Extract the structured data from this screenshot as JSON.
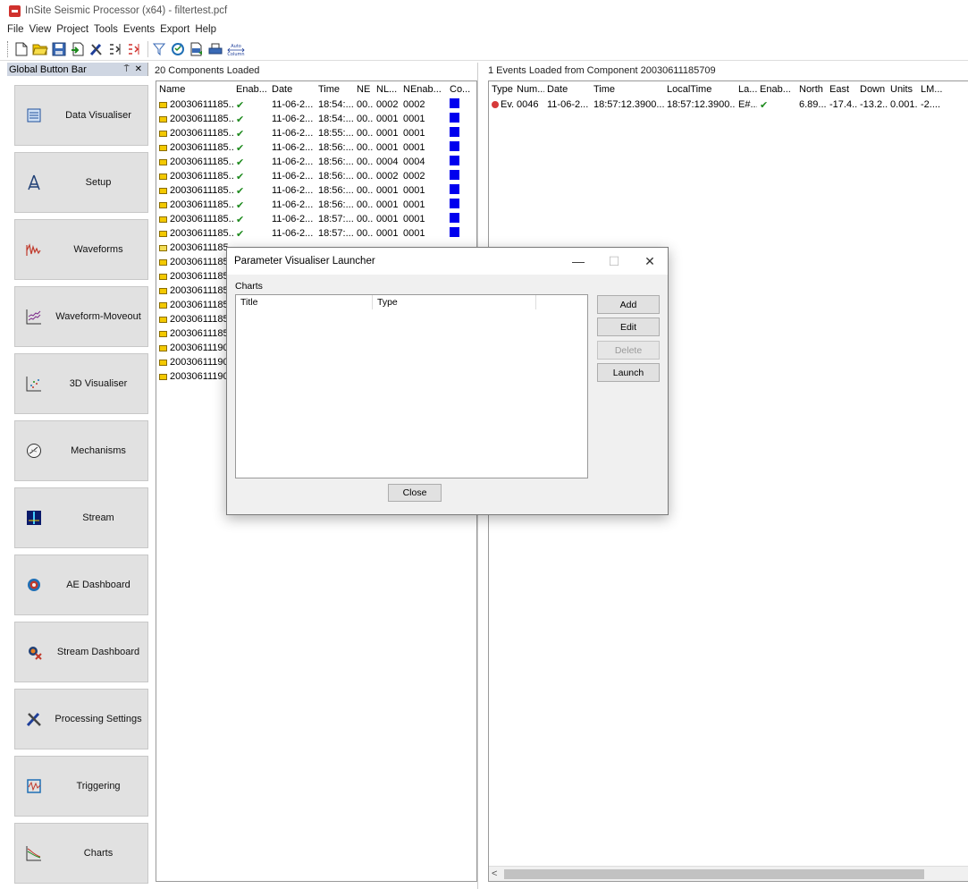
{
  "window": {
    "title": "InSite Seismic Processor (x64) - filtertest.pcf"
  },
  "menu": [
    "File",
    "View",
    "Project",
    "Tools",
    "Events",
    "Export",
    "Help"
  ],
  "toolbar": {
    "icons": [
      "new-icon",
      "open-icon",
      "save-icon",
      "import-icon",
      "tools-icon",
      "select-icon",
      "deselect-icon",
      "filter-icon",
      "refresh-icon",
      "csv-export-icon",
      "print-icon",
      "auto-column-icon"
    ],
    "auto_column_label": "Auto\nColumn"
  },
  "global_button_bar": {
    "title": "Global Button Bar",
    "pin": "⍑",
    "close": "✕",
    "buttons": [
      {
        "label": "Data Visualiser",
        "icon": "data-visualiser-icon"
      },
      {
        "label": "Setup",
        "icon": "setup-rig-icon"
      },
      {
        "label": "Waveforms",
        "icon": "waveforms-icon"
      },
      {
        "label": "Waveform-Moveout",
        "icon": "waveform-moveout-icon"
      },
      {
        "label": "3D Visualiser",
        "icon": "scatter-3d-icon"
      },
      {
        "label": "Mechanisms",
        "icon": "mechanisms-icon"
      },
      {
        "label": "Stream",
        "icon": "stream-icon"
      },
      {
        "label": "AE Dashboard",
        "icon": "ae-dashboard-icon"
      },
      {
        "label": "Stream Dashboard",
        "icon": "stream-dashboard-icon"
      },
      {
        "label": "Processing Settings",
        "icon": "processing-settings-icon"
      },
      {
        "label": "Triggering",
        "icon": "triggering-icon"
      },
      {
        "label": "Charts",
        "icon": "charts-icon"
      }
    ]
  },
  "components": {
    "header": "20 Components Loaded",
    "columns": [
      "Name",
      "Enab...",
      "Date",
      "Time",
      "NE",
      "NL...",
      "NEnab...",
      "Co..."
    ],
    "rows": [
      {
        "name": "20030611185...",
        "enabled": "✔",
        "date": "11-06-2...",
        "time": "18:54:...",
        "ne": "00...",
        "nl": "0002",
        "nenab": "0002",
        "open": false
      },
      {
        "name": "20030611185...",
        "enabled": "✔",
        "date": "11-06-2...",
        "time": "18:54:...",
        "ne": "00...",
        "nl": "0001",
        "nenab": "0001",
        "open": false
      },
      {
        "name": "20030611185...",
        "enabled": "✔",
        "date": "11-06-2...",
        "time": "18:55:...",
        "ne": "00...",
        "nl": "0001",
        "nenab": "0001",
        "open": false
      },
      {
        "name": "20030611185...",
        "enabled": "✔",
        "date": "11-06-2...",
        "time": "18:56:...",
        "ne": "00...",
        "nl": "0001",
        "nenab": "0001",
        "open": false
      },
      {
        "name": "20030611185...",
        "enabled": "✔",
        "date": "11-06-2...",
        "time": "18:56:...",
        "ne": "00...",
        "nl": "0004",
        "nenab": "0004",
        "open": false
      },
      {
        "name": "20030611185...",
        "enabled": "✔",
        "date": "11-06-2...",
        "time": "18:56:...",
        "ne": "00...",
        "nl": "0002",
        "nenab": "0002",
        "open": false
      },
      {
        "name": "20030611185...",
        "enabled": "✔",
        "date": "11-06-2...",
        "time": "18:56:...",
        "ne": "00...",
        "nl": "0001",
        "nenab": "0001",
        "open": false
      },
      {
        "name": "20030611185...",
        "enabled": "✔",
        "date": "11-06-2...",
        "time": "18:56:...",
        "ne": "00...",
        "nl": "0001",
        "nenab": "0001",
        "open": false
      },
      {
        "name": "20030611185...",
        "enabled": "✔",
        "date": "11-06-2...",
        "time": "18:57:...",
        "ne": "00...",
        "nl": "0001",
        "nenab": "0001",
        "open": false
      },
      {
        "name": "20030611185...",
        "enabled": "✔",
        "date": "11-06-2...",
        "time": "18:57:...",
        "ne": "00...",
        "nl": "0001",
        "nenab": "0001",
        "open": false
      },
      {
        "name": "20030611185",
        "enabled": "",
        "date": "",
        "time": "",
        "ne": "",
        "nl": "",
        "nenab": "",
        "open": true
      },
      {
        "name": "20030611185.",
        "enabled": "",
        "date": "",
        "time": "",
        "ne": "",
        "nl": "",
        "nenab": "",
        "open": false
      },
      {
        "name": "20030611185.",
        "enabled": "",
        "date": "",
        "time": "",
        "ne": "",
        "nl": "",
        "nenab": "",
        "open": false
      },
      {
        "name": "20030611185.",
        "enabled": "",
        "date": "",
        "time": "",
        "ne": "",
        "nl": "",
        "nenab": "",
        "open": false
      },
      {
        "name": "20030611185.",
        "enabled": "",
        "date": "",
        "time": "",
        "ne": "",
        "nl": "",
        "nenab": "",
        "open": false
      },
      {
        "name": "20030611185.",
        "enabled": "",
        "date": "",
        "time": "",
        "ne": "",
        "nl": "",
        "nenab": "",
        "open": false
      },
      {
        "name": "20030611185.",
        "enabled": "",
        "date": "",
        "time": "",
        "ne": "",
        "nl": "",
        "nenab": "",
        "open": false
      },
      {
        "name": "20030611190.",
        "enabled": "",
        "date": "",
        "time": "",
        "ne": "",
        "nl": "",
        "nenab": "",
        "open": false
      },
      {
        "name": "20030611190.",
        "enabled": "",
        "date": "",
        "time": "",
        "ne": "",
        "nl": "",
        "nenab": "",
        "open": false
      },
      {
        "name": "20030611190.",
        "enabled": "",
        "date": "",
        "time": "",
        "ne": "",
        "nl": "",
        "nenab": "",
        "open": false
      }
    ],
    "color_swatch": "#0000ee"
  },
  "events": {
    "header": "1 Events Loaded from Component 20030611185709",
    "columns": [
      "Type",
      "Num...",
      "Date",
      "Time",
      "LocalTime",
      "La...",
      "Enab...",
      "North",
      "East",
      "Down",
      "Units",
      "LM..."
    ],
    "rows": [
      {
        "type": "Ev...",
        "num": "0046",
        "date": "11-06-2...",
        "time": "18:57:12.3900...",
        "localtime": "18:57:12.3900...",
        "la": "E#...",
        "enabled": "✔",
        "north": "6.89...",
        "east": "-17.4...",
        "down": "-13.2...",
        "units": "0.001...",
        "lm": "-2...."
      }
    ],
    "scroll_left": "<"
  },
  "dialog": {
    "title": "Parameter Visualiser Launcher",
    "minimize": "—",
    "maximize": "☐",
    "close": "✕",
    "charts_label": "Charts",
    "list_columns": [
      "Title",
      "Type"
    ],
    "buttons": {
      "add": "Add",
      "edit": "Edit",
      "delete": "Delete",
      "launch": "Launch",
      "close": "Close"
    }
  }
}
